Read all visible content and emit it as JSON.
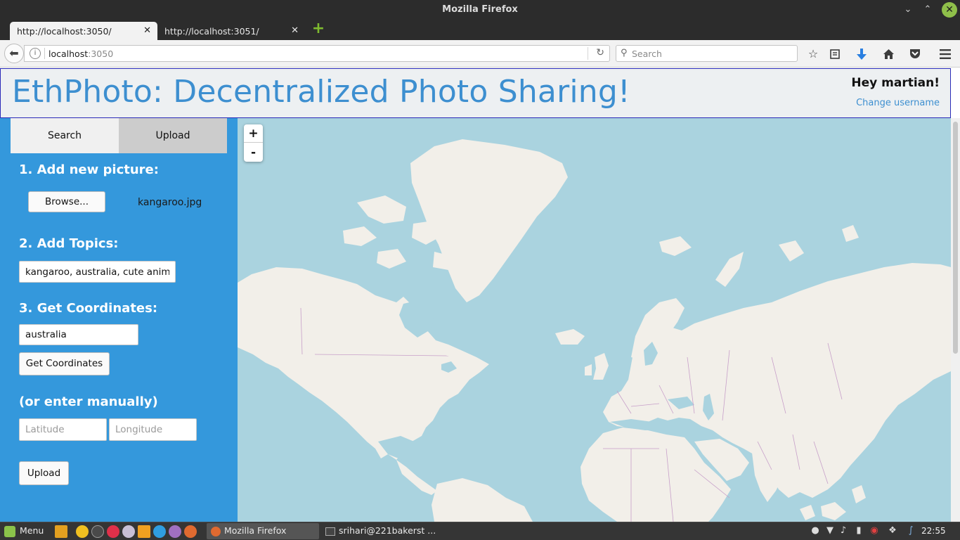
{
  "window": {
    "title": "Mozilla Firefox",
    "controls": {
      "minimize": "⌄",
      "restore": "⌃",
      "close": "✕"
    }
  },
  "tabs": [
    {
      "label": "http://localhost:3050/",
      "close": "✕",
      "active": true
    },
    {
      "label": "http://localhost:3051/",
      "close": "✕",
      "active": false
    }
  ],
  "new_tab": "+",
  "navbar": {
    "back": "⬅",
    "url_host": "localhost",
    "url_port": ":3050",
    "reload": "↻",
    "search_placeholder": "Search",
    "icons": [
      "star-icon",
      "reading-list-icon",
      "downloads-icon",
      "home-icon",
      "pocket-icon",
      "menu-icon"
    ]
  },
  "app": {
    "title": "EthPhoto: Decentralized Photo Sharing!",
    "greeting": "Hey martian!",
    "change_username": "Change username",
    "tabs": {
      "search": "Search",
      "upload": "Upload"
    },
    "step1": {
      "heading": "1. Add new picture:",
      "browse": "Browse...",
      "filename": "kangaroo.jpg"
    },
    "step2": {
      "heading": "2. Add Topics:",
      "topics_value": "kangaroo, australia, cute animal"
    },
    "step3": {
      "heading": "3. Get Coordinates:",
      "location_value": "australia",
      "get_button": "Get Coordinates"
    },
    "manual": {
      "heading": "(or enter manually)",
      "latitude_placeholder": "Latitude",
      "longitude_placeholder": "Longitude"
    },
    "upload_button": "Upload"
  },
  "map": {
    "zoom_in": "+",
    "zoom_out": "-",
    "colors": {
      "water": "#aad3df",
      "land": "#f2efe9",
      "ice": "#ffffff",
      "border": "#c5a0c8"
    }
  },
  "taskbar": {
    "menu_label": "Menu",
    "tasks": [
      {
        "label": "Mozilla Firefox"
      },
      {
        "label": "srihari@221bakerst ..."
      }
    ],
    "clock": "22:55"
  }
}
